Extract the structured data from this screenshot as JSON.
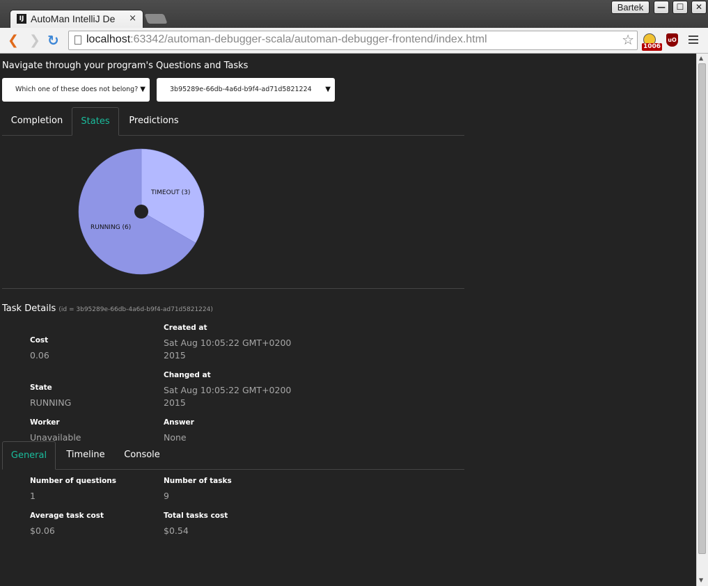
{
  "browser": {
    "tab_title": "AutoMan IntelliJ De",
    "tab_close": "×",
    "user_name": "Bartek",
    "url_host": "localhost",
    "url_rest": ":63342/automan-debugger-scala/automan-debugger-frontend/index.html",
    "extension_badge": "1006",
    "extension2_label": "uO",
    "win_minimize": "—",
    "win_maximize": "☐",
    "win_close": "✕"
  },
  "page": {
    "nav_heading": "Navigate through your program's Questions and Tasks",
    "question_select": "Which one of these does not belong?",
    "task_select": "3b95289e-66db-4a6d-b9f4-ad71d5821224",
    "top_tabs": [
      {
        "label": "Completion",
        "active": false
      },
      {
        "label": "States",
        "active": true
      },
      {
        "label": "Predictions",
        "active": false
      }
    ]
  },
  "chart_data": {
    "type": "pie",
    "slices": [
      {
        "label": "TIMEOUT (3)",
        "value": 3,
        "color": "#b3b9ff"
      },
      {
        "label": "RUNNING (6)",
        "value": 6,
        "color": "#8f95e6"
      }
    ]
  },
  "task_details": {
    "title": "Task Details",
    "id_text": "(id = 3b95289e-66db-4a6d-b9f4-ad71d5821224)",
    "cost_label": "Cost",
    "cost_value": "0.06",
    "created_label": "Created at",
    "created_value_line1": "Sat Aug 10:05:22 GMT+0200",
    "created_value_line2": "2015",
    "state_label": "State",
    "state_value": "RUNNING",
    "changed_label": "Changed at",
    "changed_value_line1": "Sat Aug 10:05:22 GMT+0200",
    "changed_value_line2": "2015",
    "worker_label": "Worker",
    "worker_value": "Unavailable",
    "answer_label": "Answer",
    "answer_value": "None"
  },
  "bottom_tabs": [
    {
      "label": "General",
      "active": true
    },
    {
      "label": "Timeline",
      "active": false
    },
    {
      "label": "Console",
      "active": false
    }
  ],
  "general": {
    "num_questions_label": "Number of questions",
    "num_questions_value": "1",
    "num_tasks_label": "Number of tasks",
    "num_tasks_value": "9",
    "avg_cost_label": "Average task cost",
    "avg_cost_value": "$0.06",
    "total_cost_label": "Total tasks cost",
    "total_cost_value": "$0.54"
  },
  "colors": {
    "accent": "#1abc9c",
    "background": "#232323"
  }
}
